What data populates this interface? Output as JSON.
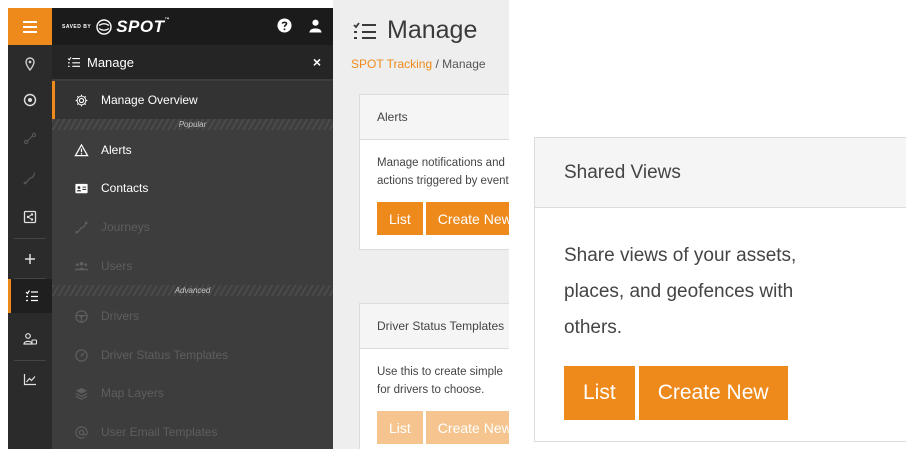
{
  "colors": {
    "accent": "#ee8a1c",
    "rail_bg": "#2b2b2b",
    "drawer_bg": "#3d3d3d",
    "header_bg": "#1b1b1b"
  },
  "brand": {
    "saved_by": "SAVED BY",
    "name": "SPOT",
    "tm": "™"
  },
  "header": {
    "help_icon": "help-circle-icon",
    "user_icon": "user-icon"
  },
  "rail": {
    "items": [
      {
        "name": "menu",
        "icon": "hamburger-icon"
      },
      {
        "name": "places",
        "icon": "map-pin-icon"
      },
      {
        "name": "tracking",
        "icon": "target-icon"
      },
      {
        "name": "routes",
        "icon": "route-icon"
      },
      {
        "name": "journeys",
        "icon": "journey-icon"
      },
      {
        "name": "share",
        "icon": "share-icon"
      },
      {
        "name": "add",
        "icon": "plus-icon"
      },
      {
        "name": "manage",
        "icon": "list-check-icon"
      },
      {
        "name": "users",
        "icon": "users-icon"
      },
      {
        "name": "reports",
        "icon": "chart-icon"
      }
    ]
  },
  "drawer": {
    "title": "Manage",
    "close": "×",
    "overview": "Manage Overview",
    "section_popular": "Popular",
    "section_advanced": "Advanced",
    "items": {
      "alerts": "Alerts",
      "contacts": "Contacts",
      "journeys": "Journeys",
      "users": "Users",
      "drivers": "Drivers",
      "driver_status_templates": "Driver Status Templates",
      "map_layers": "Map Layers",
      "user_email_templates": "User Email Templates"
    }
  },
  "main": {
    "title": "Manage",
    "breadcrumb": {
      "root": "SPOT Tracking",
      "separator": "/",
      "current": "Manage"
    },
    "cards": [
      {
        "title": "Alerts",
        "lines": [
          "Manage notifications and",
          "actions triggered by events."
        ],
        "list_button": "List",
        "create_button": "Create New"
      },
      {
        "title": "Driver Status Templates",
        "lines": [
          "Use this to create simple",
          "for drivers to choose."
        ],
        "list_button": "List",
        "create_button": "Create New"
      }
    ]
  },
  "zoom_card": {
    "title": "Shared Views",
    "lines": [
      "Share views of your assets,",
      "places, and geofences with",
      "others."
    ],
    "list_button": "List",
    "create_button": "Create New"
  }
}
